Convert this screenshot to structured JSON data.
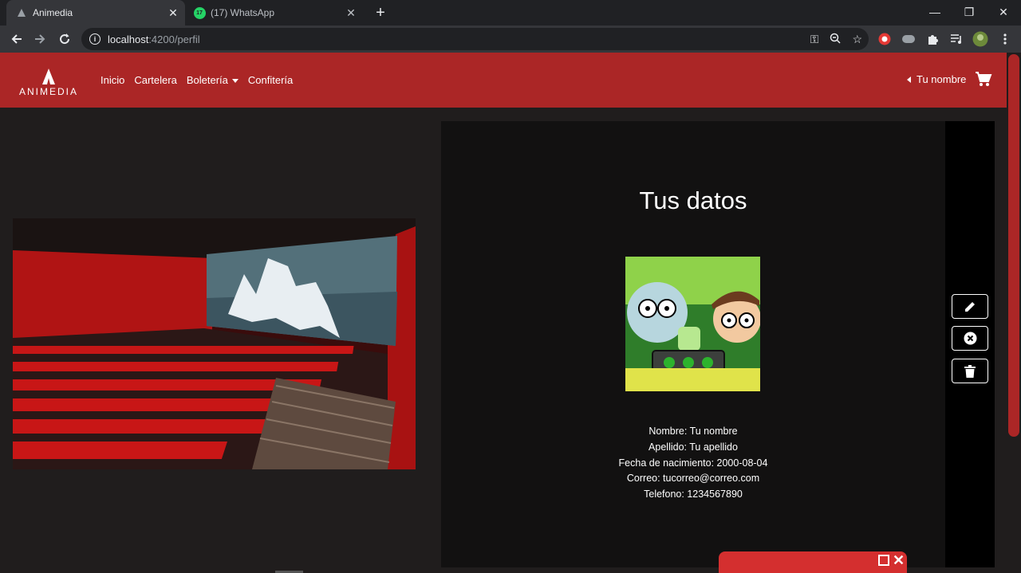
{
  "browser": {
    "tabs": [
      {
        "title": "Animedia",
        "active": true
      },
      {
        "title": "(17) WhatsApp",
        "active": false,
        "badge": "17"
      }
    ],
    "url_host": "localhost",
    "url_path": ":4200/perfil"
  },
  "navbar": {
    "brand": "ANIMEDIA",
    "links": [
      "Inicio",
      "Cartelera",
      "Boletería",
      "Confitería"
    ],
    "user_label": "Tu nombre",
    "color": "#ab2626"
  },
  "profile": {
    "title": "Tus datos",
    "fields": [
      "Nombre: Tu nombre",
      "Apellido: Tu apellido",
      "Fecha de nacimiento: 2000-08-04",
      "Correo: tucorreo@correo.com",
      "Telefono: 1234567890"
    ],
    "actions": [
      "edit-icon",
      "cancel-icon",
      "trash-icon"
    ]
  }
}
